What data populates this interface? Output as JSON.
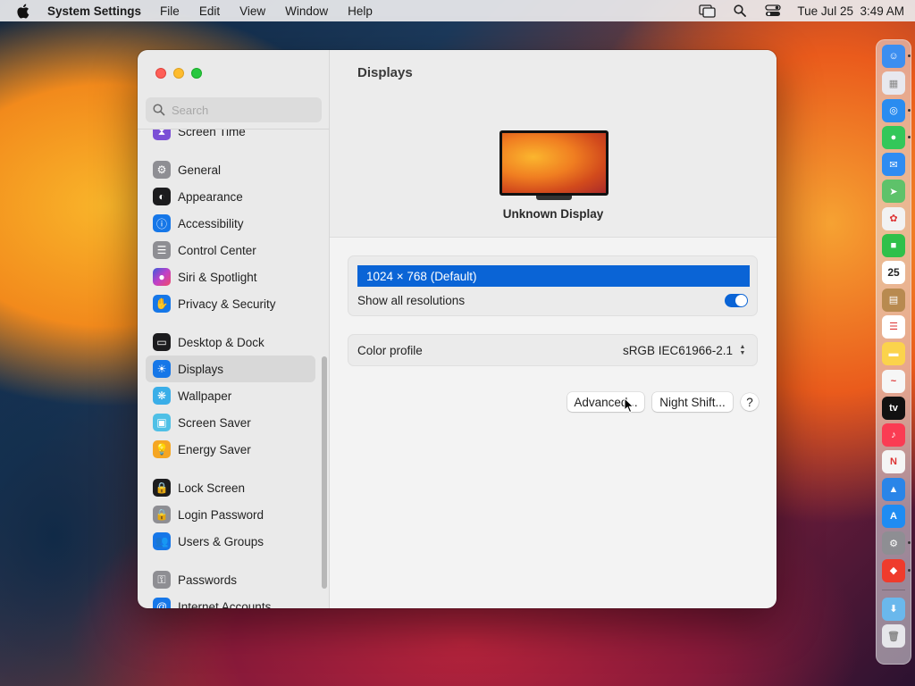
{
  "menubar": {
    "app_name": "System Settings",
    "menus": [
      "File",
      "Edit",
      "View",
      "Window",
      "Help"
    ],
    "datetime": "Tue Jul 25  3:49 AM"
  },
  "sidebar": {
    "search_placeholder": "Search",
    "items": [
      {
        "label": "Screen Time",
        "icon": "hourglass-icon",
        "color": "#7b4fd6"
      },
      {
        "label": "General",
        "icon": "gear-icon",
        "color": "#8e8e93"
      },
      {
        "label": "Appearance",
        "icon": "appearance-icon",
        "color": "#1c1c1e"
      },
      {
        "label": "Accessibility",
        "icon": "accessibility-icon",
        "color": "#1677e8"
      },
      {
        "label": "Control Center",
        "icon": "control-center-icon",
        "color": "#8e8e93"
      },
      {
        "label": "Siri & Spotlight",
        "icon": "siri-icon",
        "color": "#c040c8"
      },
      {
        "label": "Privacy & Security",
        "icon": "hand-icon",
        "color": "#1677e8"
      },
      {
        "label": "Desktop & Dock",
        "icon": "desktop-icon",
        "color": "#1c1c1e"
      },
      {
        "label": "Displays",
        "icon": "sun-icon",
        "color": "#1677e8"
      },
      {
        "label": "Wallpaper",
        "icon": "wallpaper-icon",
        "color": "#3aaee8"
      },
      {
        "label": "Screen Saver",
        "icon": "screensaver-icon",
        "color": "#4fc0e6"
      },
      {
        "label": "Energy Saver",
        "icon": "bulb-icon",
        "color": "#f5a623"
      },
      {
        "label": "Lock Screen",
        "icon": "lock-icon",
        "color": "#1c1c1e"
      },
      {
        "label": "Login Password",
        "icon": "lock-gray-icon",
        "color": "#8e8e93"
      },
      {
        "label": "Users & Groups",
        "icon": "users-icon",
        "color": "#1677e8"
      },
      {
        "label": "Passwords",
        "icon": "key-icon",
        "color": "#8e8e93"
      },
      {
        "label": "Internet Accounts",
        "icon": "at-icon",
        "color": "#1677e8"
      }
    ],
    "selected": "Displays"
  },
  "main": {
    "title": "Displays",
    "display_name": "Unknown Display",
    "resolution_selected": "1024 × 768 (Default)",
    "show_all_label": "Show all resolutions",
    "show_all_on": true,
    "color_profile_label": "Color profile",
    "color_profile_value": "sRGB IEC61966-2.1",
    "advanced_label": "Advanced...",
    "night_shift_label": "Night Shift...",
    "help_label": "?"
  },
  "dock": {
    "items": [
      {
        "name": "finder",
        "color": "#3c8ef0",
        "glyph": "☺"
      },
      {
        "name": "launchpad",
        "color": "#e8e8ee",
        "glyph": "▦"
      },
      {
        "name": "safari",
        "color": "#2a8cf0",
        "glyph": "◎"
      },
      {
        "name": "messages",
        "color": "#33c759",
        "glyph": "●"
      },
      {
        "name": "mail",
        "color": "#2f8cf2",
        "glyph": "✉"
      },
      {
        "name": "maps",
        "color": "#5ec26a",
        "glyph": "➤"
      },
      {
        "name": "photos",
        "color": "#f2f2f2",
        "glyph": "✿"
      },
      {
        "name": "facetime",
        "color": "#30c04a",
        "glyph": "■"
      },
      {
        "name": "calendar",
        "color": "#ffffff",
        "glyph": "25"
      },
      {
        "name": "notes-app",
        "color": "#b88a50",
        "glyph": "▤"
      },
      {
        "name": "reminders",
        "color": "#ffffff",
        "glyph": "☰"
      },
      {
        "name": "notes",
        "color": "#fbd34c",
        "glyph": "▬"
      },
      {
        "name": "freeform",
        "color": "#f6f6f6",
        "glyph": "~"
      },
      {
        "name": "apple-tv",
        "color": "#111111",
        "glyph": "tv"
      },
      {
        "name": "music",
        "color": "#fa3c53",
        "glyph": "♪"
      },
      {
        "name": "news",
        "color": "#f5f5f5",
        "glyph": "N"
      },
      {
        "name": "keynote",
        "color": "#2a85e8",
        "glyph": "▲"
      },
      {
        "name": "app-store",
        "color": "#1f8cf2",
        "glyph": "A"
      },
      {
        "name": "system-settings",
        "color": "#8e8e93",
        "glyph": "⚙"
      },
      {
        "name": "anydesk",
        "color": "#ef3b2c",
        "glyph": "◆"
      },
      {
        "name": "downloads-folder",
        "color": "#6ab8ec",
        "glyph": "⬇"
      },
      {
        "name": "trash",
        "color": "#e6e6ea",
        "glyph": "🗑"
      }
    ]
  }
}
